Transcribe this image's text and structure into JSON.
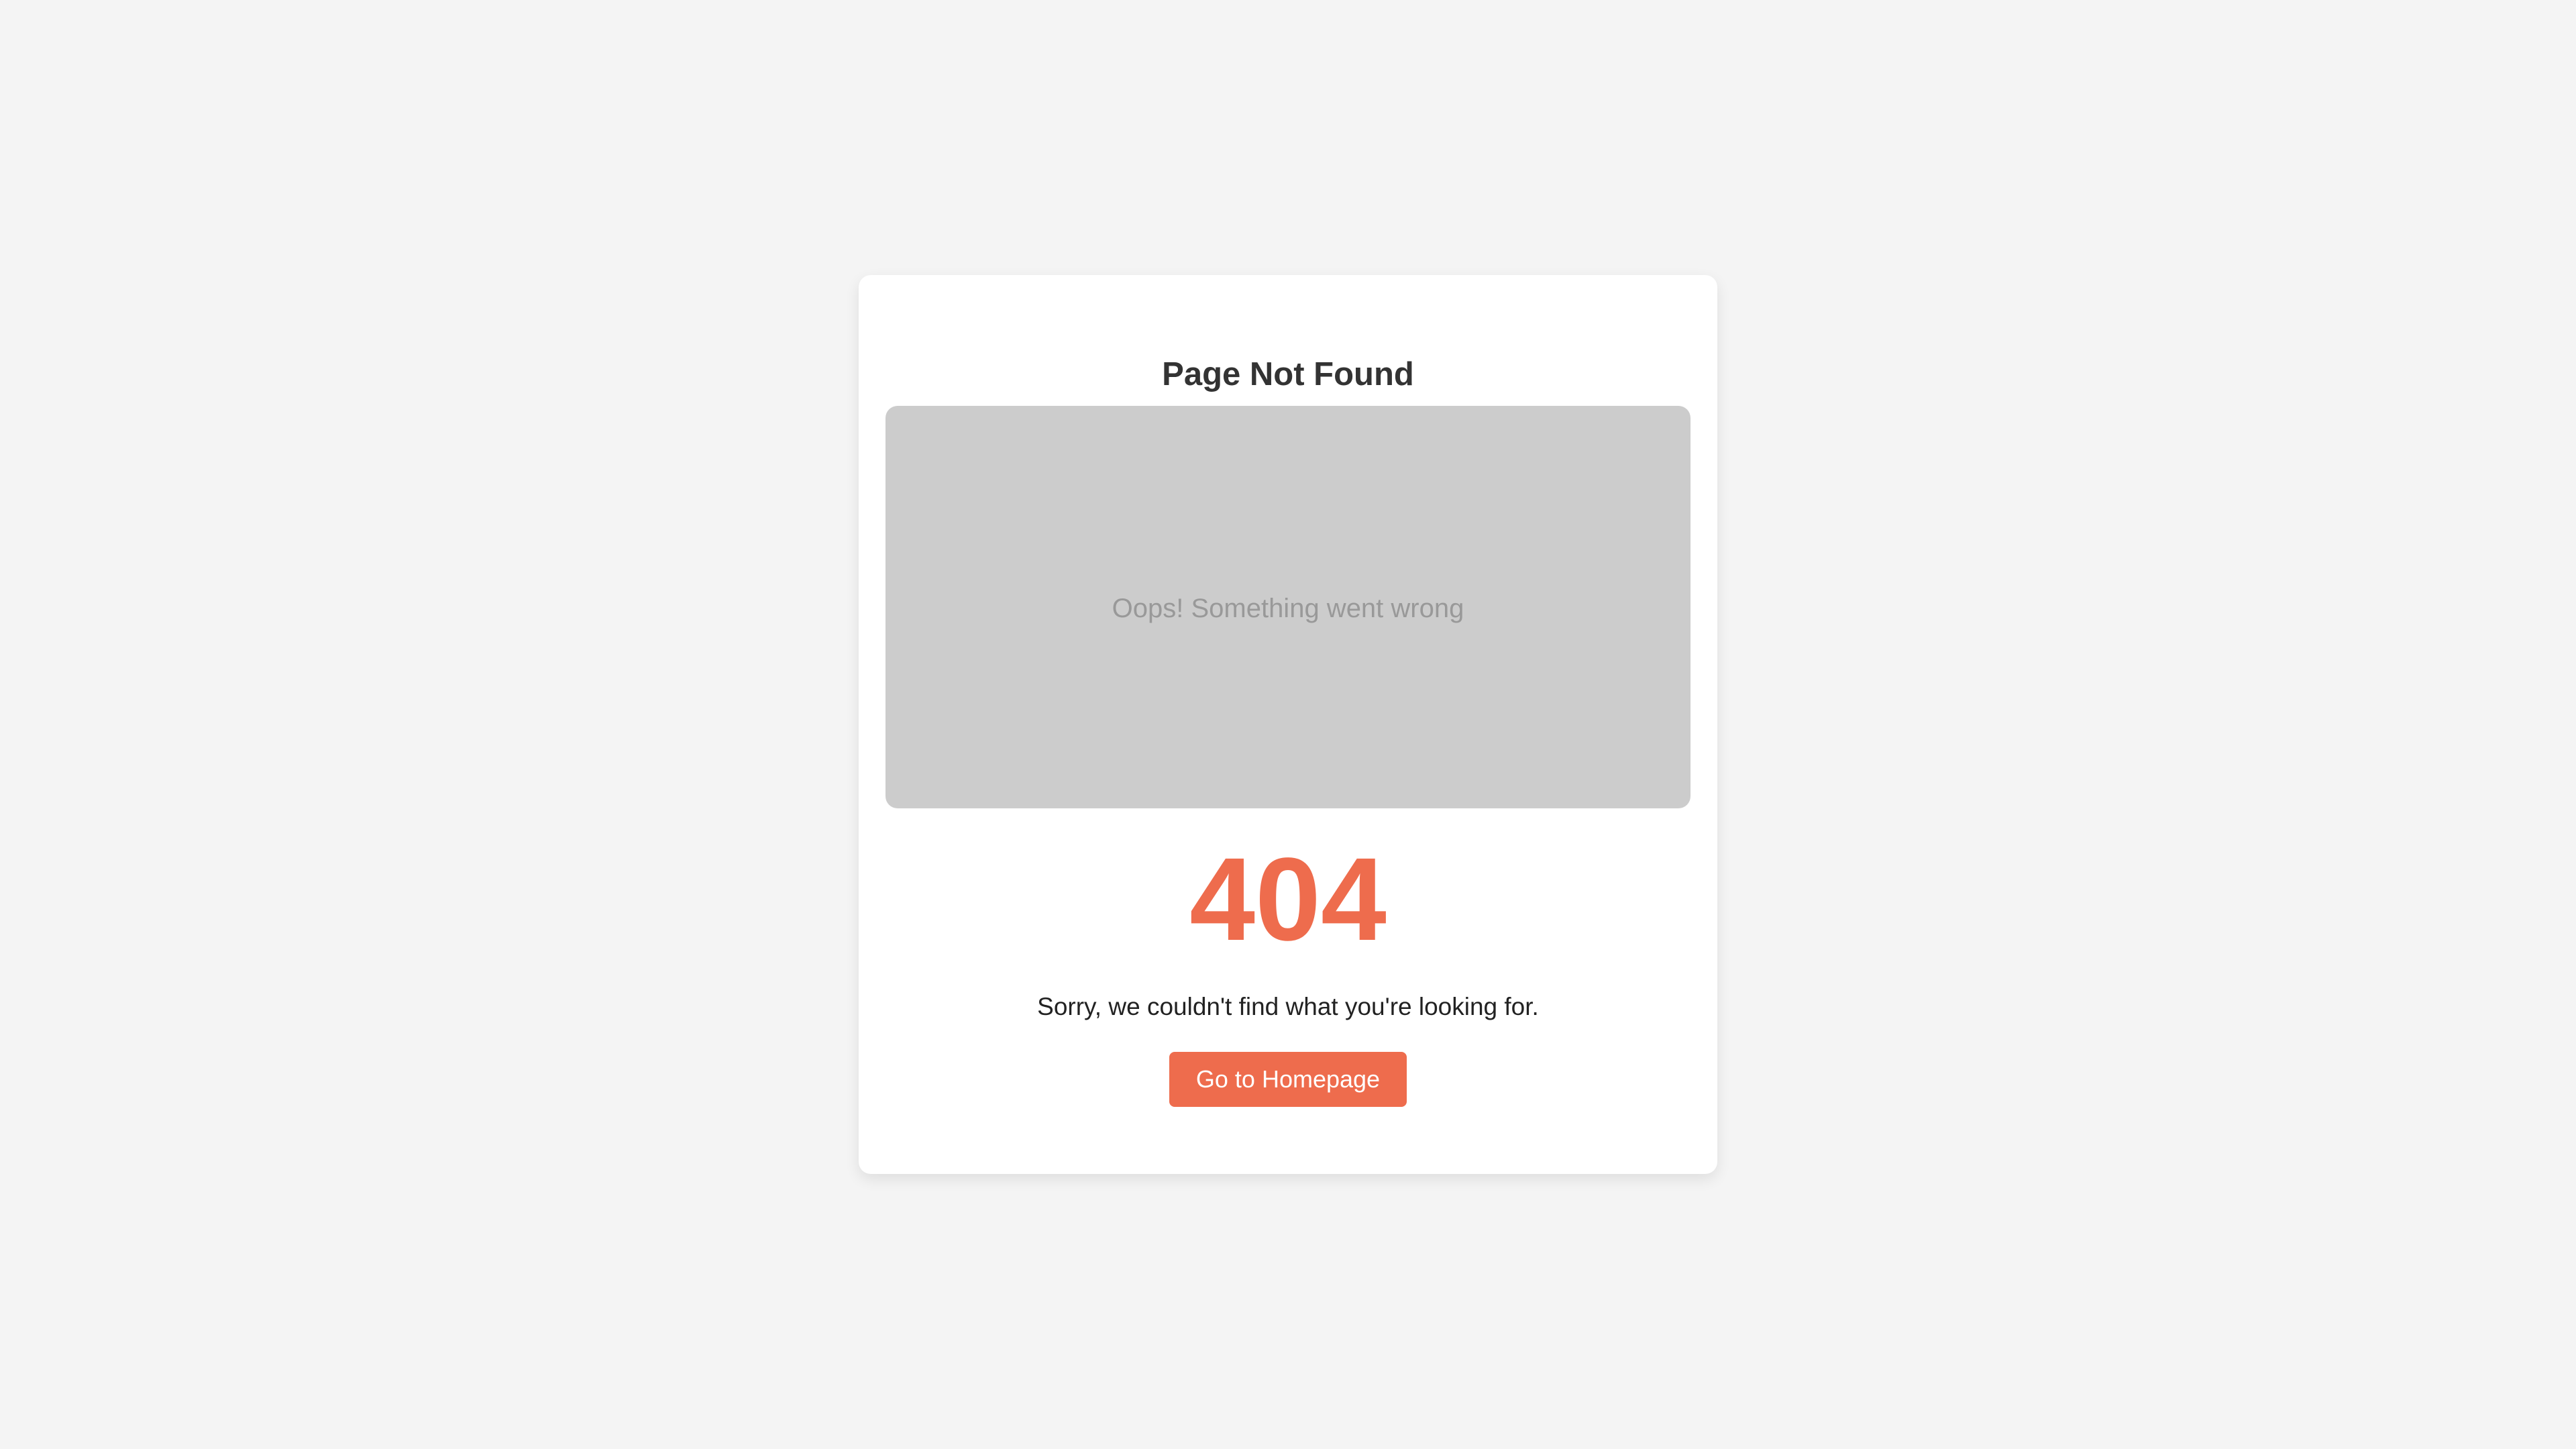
{
  "colors": {
    "page_background": "#f4f4f4",
    "card_background": "#ffffff",
    "title_text": "#333333",
    "placeholder_background": "#cccccc",
    "placeholder_text": "#999999",
    "accent": "#ee6c4d",
    "message_text": "#222222",
    "button_text": "#ffffff"
  },
  "card": {
    "title": "Page Not Found",
    "image_placeholder": {
      "text": "Oops! Something went wrong"
    },
    "error_code": "404",
    "message": "Sorry, we couldn't find what you're looking for.",
    "home_button_label": "Go to Homepage"
  }
}
